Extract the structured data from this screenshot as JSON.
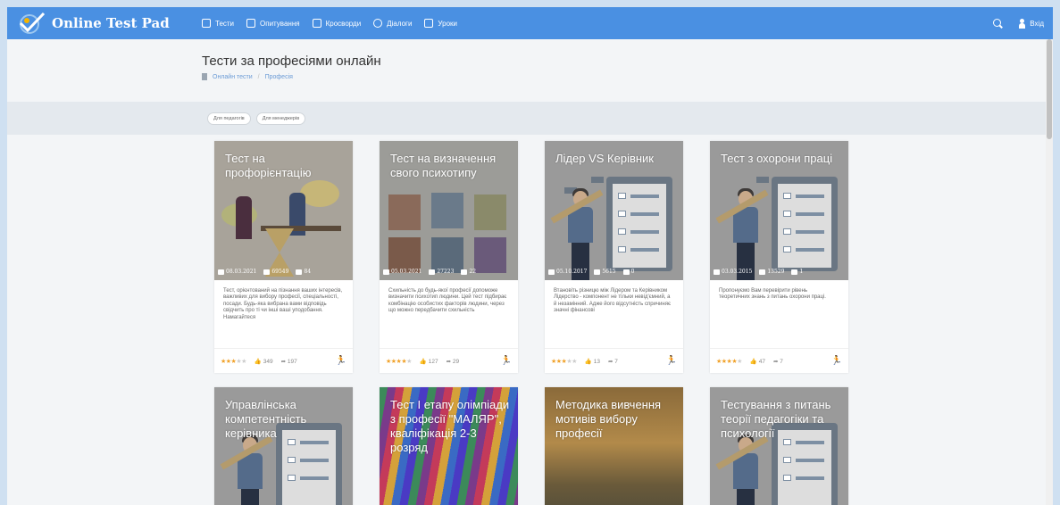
{
  "app": {
    "name": "Online Test Pad"
  },
  "nav": {
    "items": [
      {
        "label": "Тести",
        "icon": "test-icon"
      },
      {
        "label": "Опитування",
        "icon": "survey-icon"
      },
      {
        "label": "Кросворди",
        "icon": "crossword-icon"
      },
      {
        "label": "Діалоги",
        "icon": "dialog-icon"
      },
      {
        "label": "Уроки",
        "icon": "lesson-icon"
      }
    ],
    "login_label": "Вхід"
  },
  "page": {
    "title": "Тести за професіями онлайн",
    "breadcrumb": [
      "Онлайн тести",
      "Професія"
    ]
  },
  "filters": [
    "Для педагогів",
    "Для менеджерів"
  ],
  "cards": [
    {
      "title": "Тест на профорієнтацію",
      "date": "08.03.2021",
      "passed": "69549",
      "comments": "84",
      "description": "Тест, орієнтований на пізнання ваших інтересів, важливих для вибору професії, спеціальності, посади. Будь-яка вибрана вами відповідь свідчить про ті чи інші ваші уподобання. Намагайтеся",
      "rating": 3,
      "likes": "349",
      "shares": "197"
    },
    {
      "title": "Тест на визначення свого психотипу",
      "date": "05.03.2021",
      "passed": "27223",
      "comments": "22",
      "description": "Схильність до будь-якої професії допоможе визначити психотип людини. Цей тест підбирає комбінацію особистих факторів людини, через що можно передбачити схильність",
      "rating": 4,
      "likes": "127",
      "shares": "29"
    },
    {
      "title": "Лідер VS Керівник",
      "date": "05.10.2017",
      "passed": "5615",
      "comments": "0",
      "description": "Втановіть різницю між Лідером та Керівником Лідерство - компонент не тільки невід'ємний, а й незамінний. Адже його відсутність спричиняє значні фінансові",
      "rating": 3,
      "likes": "13",
      "shares": "7"
    },
    {
      "title": "Тест з охорони праці",
      "date": "03.03.2015",
      "passed": "13529",
      "comments": "1",
      "description": "Пропонуємо Вам перевірити рівень теоретичних знань з питань охорони праці.",
      "rating": 4,
      "likes": "47",
      "shares": "7"
    },
    {
      "title": "Управлінська компетентність керівника"
    },
    {
      "title": "Тест І етапу олімпіади з професії \"МАЛЯР\", кваліфікація 2-3 розряд"
    },
    {
      "title": "Методика вивчення мотивів вибору професії"
    },
    {
      "title": "Тестування з питань теорії педагогіки та психології"
    }
  ],
  "colors": {
    "topbar": "#4a90e2",
    "star": "#f1a22a",
    "link": "#6b9bd6"
  }
}
